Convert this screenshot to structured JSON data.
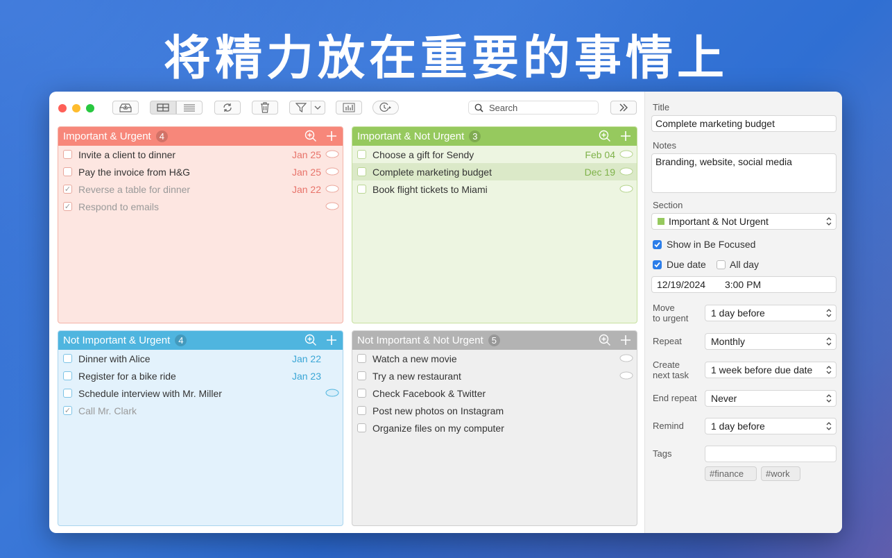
{
  "headline": "将精力放在重要的事情上",
  "toolbar": {
    "search_placeholder": "Search"
  },
  "quadrants": [
    {
      "title": "Important & Urgent",
      "count": "4",
      "tasks": [
        {
          "text": "Invite a client to dinner",
          "date": "Jan 25",
          "done": false
        },
        {
          "text": "Pay the invoice from H&G",
          "date": "Jan 25",
          "done": false
        },
        {
          "text": "Reverse a table for dinner",
          "date": "Jan 22",
          "done": true
        },
        {
          "text": "Respond to emails",
          "date": "",
          "done": true
        }
      ]
    },
    {
      "title": "Important & Not Urgent",
      "count": "3",
      "tasks": [
        {
          "text": "Choose a gift for Sendy",
          "date": "Feb 04",
          "done": false
        },
        {
          "text": "Complete marketing budget",
          "date": "Dec 19",
          "done": false
        },
        {
          "text": "Book flight tickets to Miami",
          "date": "",
          "done": false
        }
      ]
    },
    {
      "title": "Not Important & Urgent",
      "count": "4",
      "tasks": [
        {
          "text": "Dinner with Alice",
          "date": "Jan 22",
          "done": false
        },
        {
          "text": "Register for a bike ride",
          "date": "Jan 23",
          "done": false
        },
        {
          "text": "Schedule interview with Mr. Miller",
          "date": "",
          "done": false
        },
        {
          "text": "Call Mr. Clark",
          "date": "",
          "done": true
        }
      ]
    },
    {
      "title": "Not Important & Not Urgent",
      "count": "5",
      "tasks": [
        {
          "text": "Watch a new movie",
          "date": "",
          "done": false
        },
        {
          "text": "Try a new restaurant",
          "date": "",
          "done": false
        },
        {
          "text": "Check Facebook & Twitter",
          "date": "",
          "done": false
        },
        {
          "text": "Post new photos on Instagram",
          "date": "",
          "done": false
        },
        {
          "text": "Organize files on my computer",
          "date": "",
          "done": false
        }
      ]
    }
  ],
  "colors": {
    "urgent_important": "#f7877a",
    "important_not_urgent": "#96c95e",
    "urgent_not_important": "#4fb5df",
    "neither": "#b3b3b3"
  },
  "detail": {
    "title_label": "Title",
    "title_value": "Complete marketing budget",
    "notes_label": "Notes",
    "notes_value": "Branding, website, social media",
    "section_label": "Section",
    "section_value": "Important & Not Urgent",
    "show_focused_label": "Show in Be Focused",
    "due_date_label": "Due date",
    "all_day_label": "All day",
    "date_value": "12/19/2024",
    "time_value": "3:00 PM",
    "move_label_1": "Move",
    "move_label_2": "to urgent",
    "move_value": "1 day before",
    "repeat_label": "Repeat",
    "repeat_value": "Monthly",
    "create_label_1": "Create",
    "create_label_2": "next task",
    "create_value": "1 week before due date",
    "end_repeat_label": "End repeat",
    "end_repeat_value": "Never",
    "remind_label": "Remind",
    "remind_value": "1 day before",
    "tags_label": "Tags",
    "tags": [
      "#finance",
      "#work"
    ]
  }
}
